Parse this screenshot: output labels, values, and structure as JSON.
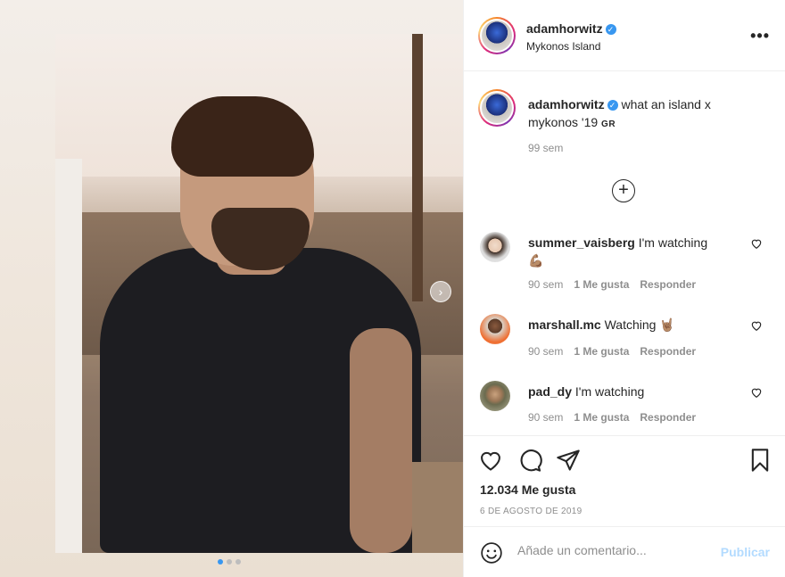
{
  "post": {
    "username": "adamhorwitz",
    "location": "Mykonos Island",
    "caption": "what an island x mykonos '19",
    "caption_flag": "GR",
    "caption_time": "99 sem",
    "likes": "12.034 Me gusta",
    "date": "6 DE AGOSTO DE 2019",
    "carousel": {
      "slides": 3,
      "active": 0
    }
  },
  "comments": [
    {
      "username": "summer_vaisberg",
      "text": "I'm watching",
      "emoji": "💪🏽",
      "time": "90 sem",
      "likes": "1 Me gusta",
      "reply": "Responder"
    },
    {
      "username": "marshall.mc",
      "text": "Watching",
      "emoji": "🤘🏽",
      "time": "90 sem",
      "likes": "1 Me gusta",
      "reply": "Responder"
    },
    {
      "username": "pad_dy",
      "text": "I'm watching",
      "emoji": "",
      "time": "90 sem",
      "likes": "1 Me gusta",
      "reply": "Responder"
    }
  ],
  "comment_box": {
    "placeholder": "Añade un comentario...",
    "publish": "Publicar"
  },
  "icons": {
    "more": "more-options-icon",
    "verified": "verified-badge-icon",
    "load_more": "plus-circle-icon",
    "like": "heart-icon",
    "comment": "comment-bubble-icon",
    "share": "paper-plane-icon",
    "save": "bookmark-icon",
    "emoji": "smiley-icon",
    "next": "chevron-right-icon"
  },
  "colors": {
    "verified": "#3897f0",
    "publish": "#b3dbff",
    "secondary_text": "#8e8e8e",
    "carousel_active": "#3897f0"
  }
}
